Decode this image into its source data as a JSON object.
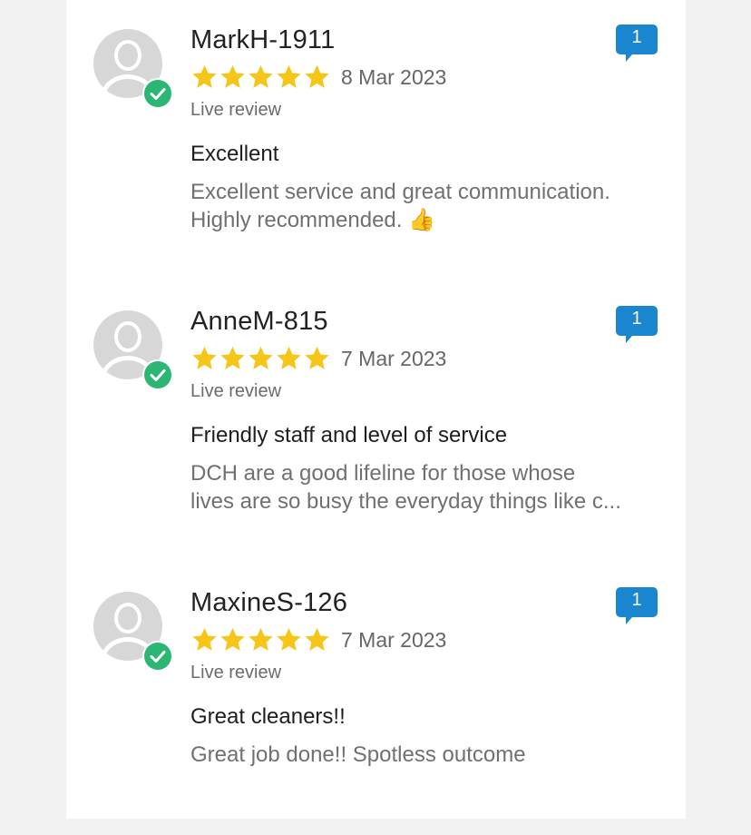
{
  "reviews": [
    {
      "name": "MarkH-1911",
      "rating": 5,
      "date": "8 Mar 2023",
      "status": "Live review",
      "title": "Excellent",
      "body_line1": "Excellent service and great communication.",
      "body_line2": "Highly recommended. 👍",
      "comment_count": "1"
    },
    {
      "name": "AnneM-815",
      "rating": 5,
      "date": "7 Mar 2023",
      "status": "Live review",
      "title": "Friendly staff and level of service",
      "body_line1": "DCH are a good lifeline for those whose",
      "body_line2": "lives are so busy the everyday things like c...",
      "comment_count": "1"
    },
    {
      "name": "MaxineS-126",
      "rating": 5,
      "date": "7 Mar 2023",
      "status": "Live review",
      "title": "Great cleaners!!",
      "body_line1": "Great job done!! Spotless outcome",
      "body_line2": "",
      "comment_count": "1"
    }
  ],
  "colors": {
    "star": "#f5c518",
    "verified": "#2bb673",
    "comment_badge": "#1a86d0",
    "background": "#f2f2f2",
    "card": "#ffffff"
  },
  "icons": {
    "avatar": "user-silhouette-icon",
    "verified": "check-circle-icon",
    "star": "star-icon",
    "comment": "comment-bubble-icon"
  }
}
